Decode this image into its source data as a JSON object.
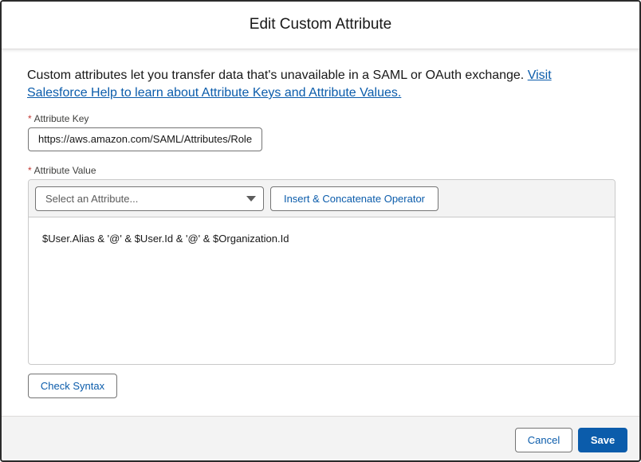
{
  "modal": {
    "title": "Edit Custom Attribute"
  },
  "intro": {
    "text": "Custom attributes let you transfer data that's unavailable in a SAML or OAuth exchange. ",
    "link_text": "Visit Salesforce Help to learn about Attribute Keys and Attribute Values."
  },
  "attribute_key": {
    "required_marker": "*",
    "label": "Attribute Key",
    "value": "https://aws.amazon.com/SAML/Attributes/Role"
  },
  "attribute_value": {
    "required_marker": "*",
    "label": "Attribute Value",
    "select_placeholder": "Select an Attribute...",
    "insert_button_label": "Insert & Concatenate Operator",
    "formula": "$User.Alias & '@' & $User.Id & '@' & $Organization.Id"
  },
  "check_syntax_label": "Check Syntax",
  "footer": {
    "cancel_label": "Cancel",
    "save_label": "Save"
  },
  "colors": {
    "brand": "#0b5cab",
    "required": "#c23934",
    "footer_bg": "#f3f3f3"
  },
  "icons": {
    "select_caret": "chevron-down-icon"
  }
}
